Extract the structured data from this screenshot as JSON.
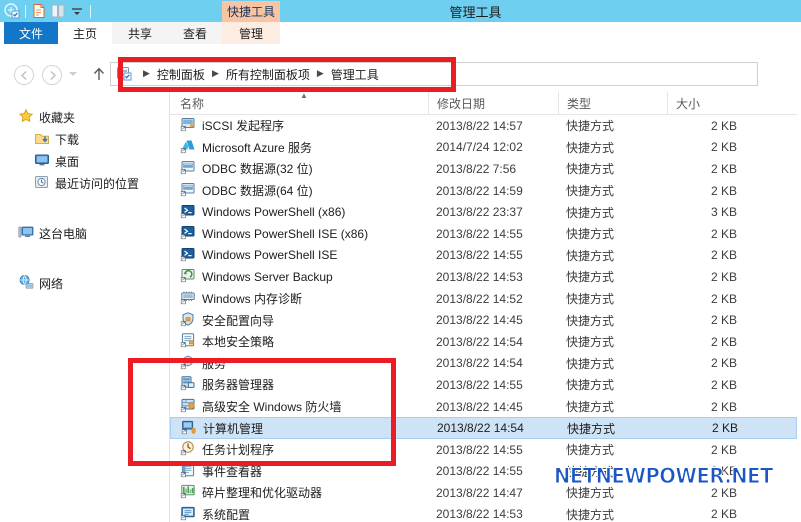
{
  "window": {
    "title": "管理工具",
    "titlebar_color": "#6ecff0",
    "accent_color": "#1277c8",
    "annotation_color": "#ec1c24"
  },
  "quick_access": [
    {
      "name": "folder-properties-icon",
      "label": "属性"
    },
    {
      "name": "new-folder-icon",
      "label": "新建文件夹"
    },
    {
      "name": "open-book-icon",
      "label": "打开"
    },
    {
      "name": "chevron-down-icon",
      "label": "自定义快速访问工具栏"
    }
  ],
  "ribbon": {
    "contextual_group": "快捷工具",
    "tabs": [
      {
        "label": "文件",
        "state": "file"
      },
      {
        "label": "主页",
        "state": "active"
      },
      {
        "label": "共享",
        "state": "normal"
      },
      {
        "label": "查看",
        "state": "normal"
      },
      {
        "label": "管理",
        "state": "contextual"
      }
    ]
  },
  "nav": {
    "back": "后退",
    "forward": "前进",
    "recent": "最近的位置",
    "up": "上移一级"
  },
  "address": {
    "icon": "control-panel-icon",
    "crumbs": [
      "控制面板",
      "所有控制面板项",
      "管理工具"
    ],
    "separator": "▶"
  },
  "sidebar": {
    "items": [
      {
        "label": "收藏夹",
        "icon": "star-icon",
        "level": "root"
      },
      {
        "label": "下载",
        "icon": "download-icon",
        "level": "child"
      },
      {
        "label": "桌面",
        "icon": "desktop-icon",
        "level": "child"
      },
      {
        "label": "最近访问的位置",
        "icon": "recent-icon",
        "level": "child"
      },
      {
        "label": "这台电脑",
        "icon": "computer-icon",
        "level": "root"
      },
      {
        "label": "网络",
        "icon": "network-icon",
        "level": "root"
      }
    ]
  },
  "list": {
    "columns": [
      "名称",
      "修改日期",
      "类型",
      "大小"
    ],
    "sorted_by": "名称",
    "sort_direction": "ascending",
    "rows": [
      {
        "name": "iSCSI 发起程序",
        "date": "2013/8/22 14:57",
        "type": "快捷方式",
        "size": "2 KB",
        "icon": "iscsi-icon",
        "selected": false
      },
      {
        "name": "Microsoft Azure 服务",
        "date": "2014/7/24 12:02",
        "type": "快捷方式",
        "size": "2 KB",
        "icon": "azure-icon",
        "selected": false
      },
      {
        "name": "ODBC 数据源(32 位)",
        "date": "2013/8/22 7:56",
        "type": "快捷方式",
        "size": "2 KB",
        "icon": "odbc-icon",
        "selected": false
      },
      {
        "name": "ODBC 数据源(64 位)",
        "date": "2013/8/22 14:59",
        "type": "快捷方式",
        "size": "2 KB",
        "icon": "odbc-icon",
        "selected": false
      },
      {
        "name": "Windows PowerShell (x86)",
        "date": "2013/8/22 23:37",
        "type": "快捷方式",
        "size": "3 KB",
        "icon": "powershell-icon",
        "selected": false
      },
      {
        "name": "Windows PowerShell ISE (x86)",
        "date": "2013/8/22 14:55",
        "type": "快捷方式",
        "size": "2 KB",
        "icon": "powershell-icon",
        "selected": false
      },
      {
        "name": "Windows PowerShell ISE",
        "date": "2013/8/22 14:55",
        "type": "快捷方式",
        "size": "2 KB",
        "icon": "powershell-icon",
        "selected": false
      },
      {
        "name": "Windows Server Backup",
        "date": "2013/8/22 14:53",
        "type": "快捷方式",
        "size": "2 KB",
        "icon": "backup-icon",
        "selected": false
      },
      {
        "name": "Windows 内存诊断",
        "date": "2013/8/22 14:52",
        "type": "快捷方式",
        "size": "2 KB",
        "icon": "memory-icon",
        "selected": false
      },
      {
        "name": "安全配置向导",
        "date": "2013/8/22 14:45",
        "type": "快捷方式",
        "size": "2 KB",
        "icon": "security-icon",
        "selected": false
      },
      {
        "name": "本地安全策略",
        "date": "2013/8/22 14:54",
        "type": "快捷方式",
        "size": "2 KB",
        "icon": "policy-icon",
        "selected": false
      },
      {
        "name": "服务",
        "date": "2013/8/22 14:54",
        "type": "快捷方式",
        "size": "2 KB",
        "icon": "services-icon",
        "selected": false
      },
      {
        "name": "服务器管理器",
        "date": "2013/8/22 14:55",
        "type": "快捷方式",
        "size": "2 KB",
        "icon": "servermgr-icon",
        "selected": false
      },
      {
        "name": "高级安全 Windows 防火墙",
        "date": "2013/8/22 14:45",
        "type": "快捷方式",
        "size": "2 KB",
        "icon": "firewall-icon",
        "selected": false
      },
      {
        "name": "计算机管理",
        "date": "2013/8/22 14:54",
        "type": "快捷方式",
        "size": "2 KB",
        "icon": "compmgmt-icon",
        "selected": true
      },
      {
        "name": "任务计划程序",
        "date": "2013/8/22 14:55",
        "type": "快捷方式",
        "size": "2 KB",
        "icon": "taskschd-icon",
        "selected": false
      },
      {
        "name": "事件查看器",
        "date": "2013/8/22 14:55",
        "type": "快捷方式",
        "size": "2 KB",
        "icon": "eventvwr-icon",
        "selected": false
      },
      {
        "name": "碎片整理和优化驱动器",
        "date": "2013/8/22 14:47",
        "type": "快捷方式",
        "size": "2 KB",
        "icon": "defrag-icon",
        "selected": false
      },
      {
        "name": "系统配置",
        "date": "2013/8/22 14:53",
        "type": "快捷方式",
        "size": "2 KB",
        "icon": "msconfig-icon",
        "selected": false
      }
    ]
  },
  "annotations": [
    {
      "name": "address-bar-highlight",
      "target": "地址栏"
    },
    {
      "name": "admin-tools-highlight",
      "target": "服务器管理器 / 高级安全 Windows 防火墙 / 计算机管理 / 任务计划程序"
    }
  ],
  "watermark": {
    "text": "NETNEWPOWER.NET",
    "color": "#1a56c4"
  }
}
